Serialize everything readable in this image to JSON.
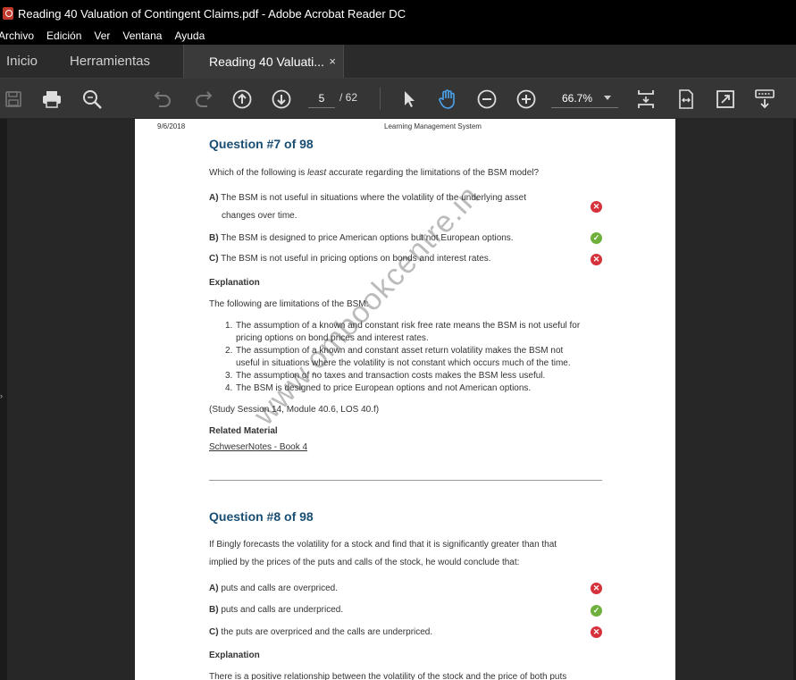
{
  "window": {
    "title": "Reading 40 Valuation of Contingent Claims.pdf - Adobe Acrobat Reader DC"
  },
  "menu": [
    "Archivo",
    "Edición",
    "Ver",
    "Ventana",
    "Ayuda"
  ],
  "tabs": {
    "home": "Inicio",
    "tools": "Herramientas",
    "document": "Reading 40 Valuati...",
    "close": "×"
  },
  "toolbar": {
    "page_current": "5",
    "page_total": "/ 62",
    "zoom": "66.7%"
  },
  "page": {
    "header_date": "9/6/2018",
    "header_site": "Learning Management System",
    "q7": {
      "title": "Question #7 of 98",
      "text_before": "Which of the following is ",
      "text_em": "least",
      "text_after": " accurate regarding the limitations of the BSM model?",
      "opt_a_letter": "A)",
      "opt_a_line1": "The BSM is not useful in situations where the volatility of the underlying asset",
      "opt_a_line2": "changes over time.",
      "opt_b_letter": "B)",
      "opt_b": "The BSM is designed to price American options but not European options.",
      "opt_c_letter": "C)",
      "opt_c": "The BSM is not useful in pricing options on bonds and interest rates.",
      "explanation_h": "Explanation",
      "explanation_intro": "The following are limitations of the BSM:",
      "list": [
        {
          "n": "1.",
          "l1": "The assumption of a known and constant risk free rate means the BSM is not useful for",
          "l2": "pricing options on bond prices and interest rates."
        },
        {
          "n": "2.",
          "l1": "The assumption of a known and constant asset return volatility makes the BSM not",
          "l2": "useful in situations where the volatility is not constant which occurs much of the time."
        },
        {
          "n": "3.",
          "l1": "The assumption of no taxes and transaction costs makes the BSM less useful.",
          "l2": ""
        },
        {
          "n": "4.",
          "l1": "The BSM is designed to price European options and not American options.",
          "l2": ""
        }
      ],
      "reference": "(Study Session 14, Module 40.6, LOS 40.f)",
      "related_h": "Related Material",
      "related_link": "SchweserNotes - Book 4"
    },
    "q8": {
      "title": "Question #8 of 98",
      "text_line1": "If Bingly forecasts the volatility for a stock and find that it is significantly greater than that",
      "text_line2": "implied by the prices of the puts and calls of the stock, he would conclude that:",
      "opt_a_letter": "A)",
      "opt_a": "puts and calls are overpriced.",
      "opt_b_letter": "B)",
      "opt_b": "puts and calls are underpriced.",
      "opt_c_letter": "C)",
      "opt_c": "the puts are overpriced and the calls are underpriced.",
      "explanation_h": "Explanation",
      "explanation_start": "There is a positive relationship between the volatility of the stock and the price of both puts"
    },
    "watermark": "www.ombookcentre.in"
  },
  "colors": {
    "accent_blue": "#4aa3f0",
    "title_blue": "#1a4e73",
    "wrong": "#d6323c",
    "right": "#6fb03c"
  }
}
